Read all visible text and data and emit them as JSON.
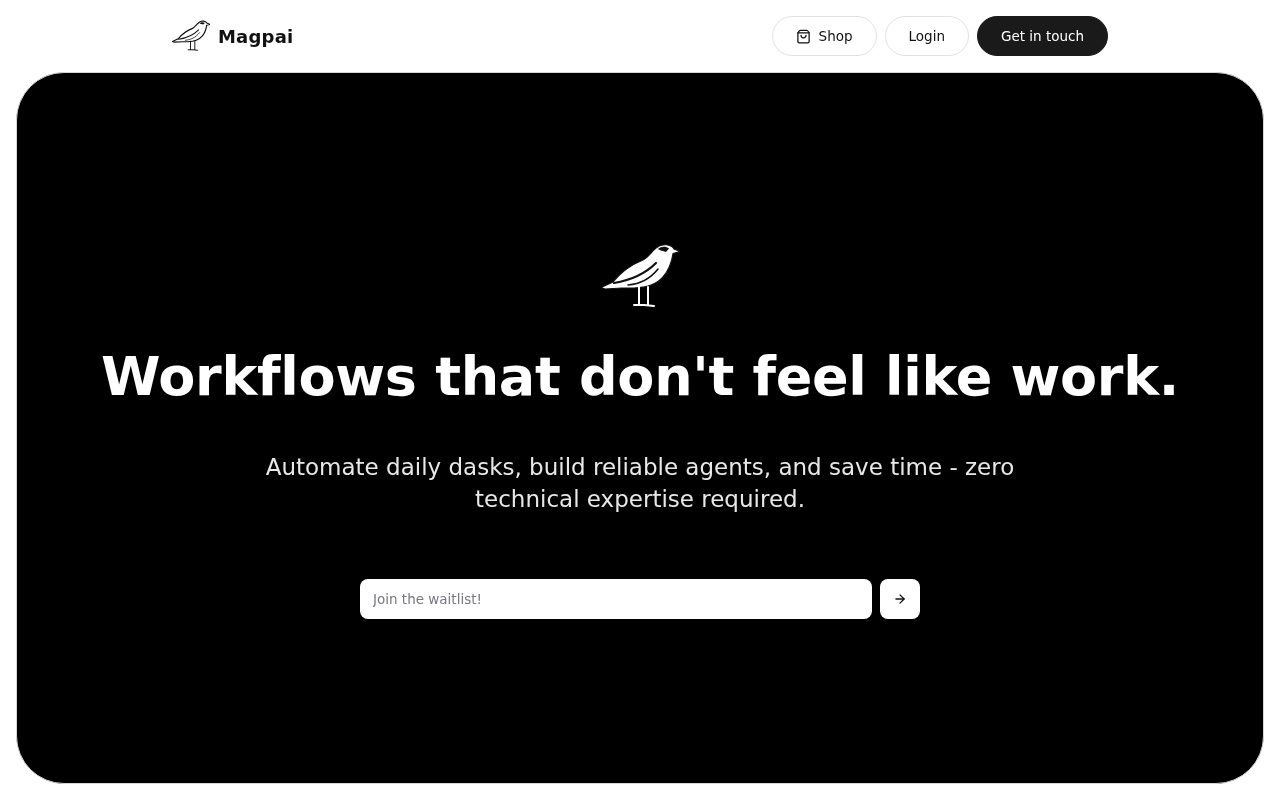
{
  "header": {
    "brand": "Magpai",
    "nav": [
      {
        "label": "Shop",
        "kind": "iconic"
      },
      {
        "label": "Login",
        "kind": "outline"
      },
      {
        "label": "Get in touch",
        "kind": "solid"
      }
    ]
  },
  "hero": {
    "headline": "Workflows that don't feel like work.",
    "subtitle": "Automate daily dasks, build reliable agents, and save time - zero technical expertise required.",
    "waitlist": {
      "placeholder": "Join the waitlist!"
    }
  }
}
